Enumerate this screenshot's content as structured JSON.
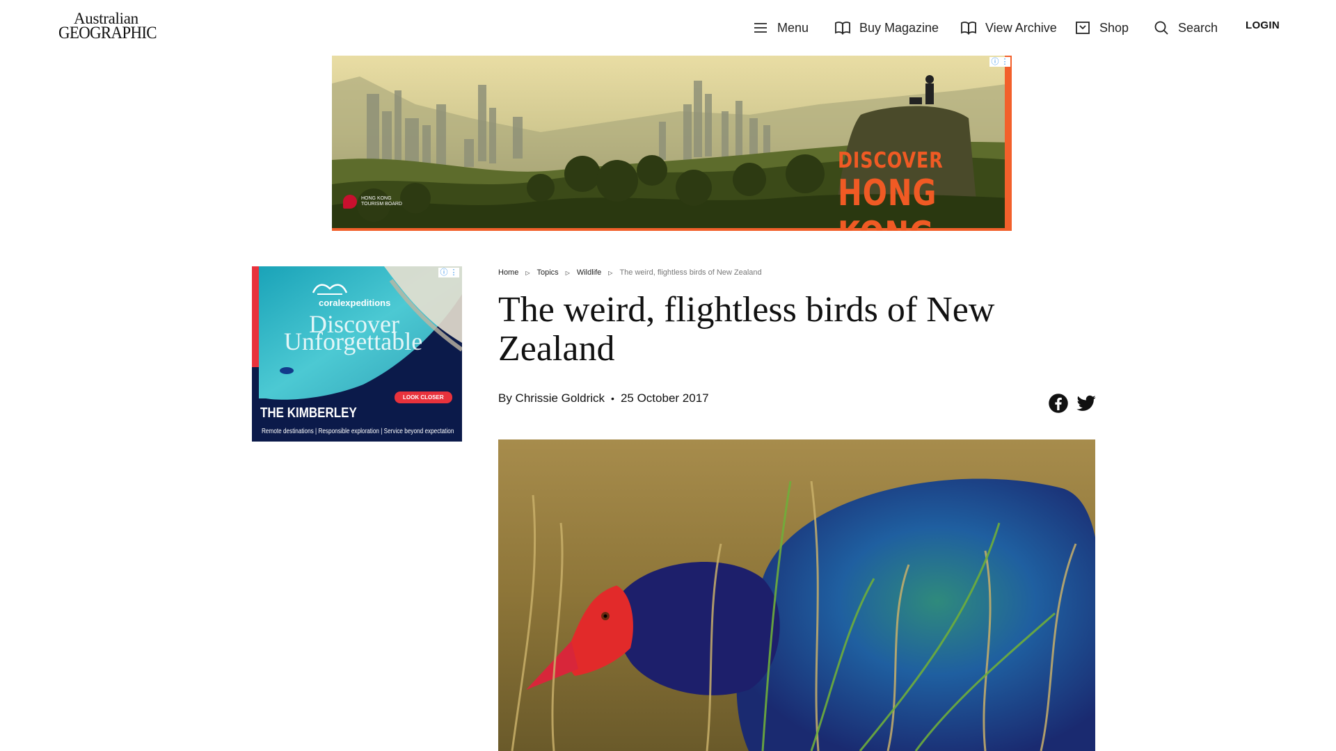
{
  "header": {
    "logo_top": "Australian",
    "logo_bottom": "GEOGRAPHIC",
    "nav": {
      "menu": "Menu",
      "buy_magazine": "Buy Magazine",
      "view_archive": "View Archive",
      "shop": "Shop",
      "search": "Search"
    },
    "login": "LOGIN"
  },
  "ads": {
    "top": {
      "discover": "DISCOVER",
      "hong_kong": "HONG KONG",
      "sponsor": "HONG KONG TOURISM BOARD"
    },
    "side": {
      "brand": "coralexpeditions",
      "headline_1": "Discover",
      "headline_2": "Unforgettable",
      "cta": "LOOK CLOSER",
      "title": "THE KIMBERLEY",
      "subtitle": "Remote destinations | Responsible exploration | Service beyond expectation"
    }
  },
  "breadcrumb": {
    "home": "Home",
    "topics": "Topics",
    "wildlife": "Wildlife",
    "current": "The weird, flightless birds of New Zealand"
  },
  "article": {
    "title": "The weird, flightless birds of New Zealand",
    "author": "By Chrissie Goldrick",
    "date": "25 October 2017"
  },
  "icons": {
    "menu": "menu-icon",
    "book": "book-icon",
    "shop": "shop-icon",
    "search": "search-icon",
    "facebook": "facebook-icon",
    "twitter": "twitter-icon"
  },
  "colors": {
    "ad_accent": "#f05a24",
    "coral_accent": "#e8323c",
    "coral_bg": "#0b1a4a"
  }
}
